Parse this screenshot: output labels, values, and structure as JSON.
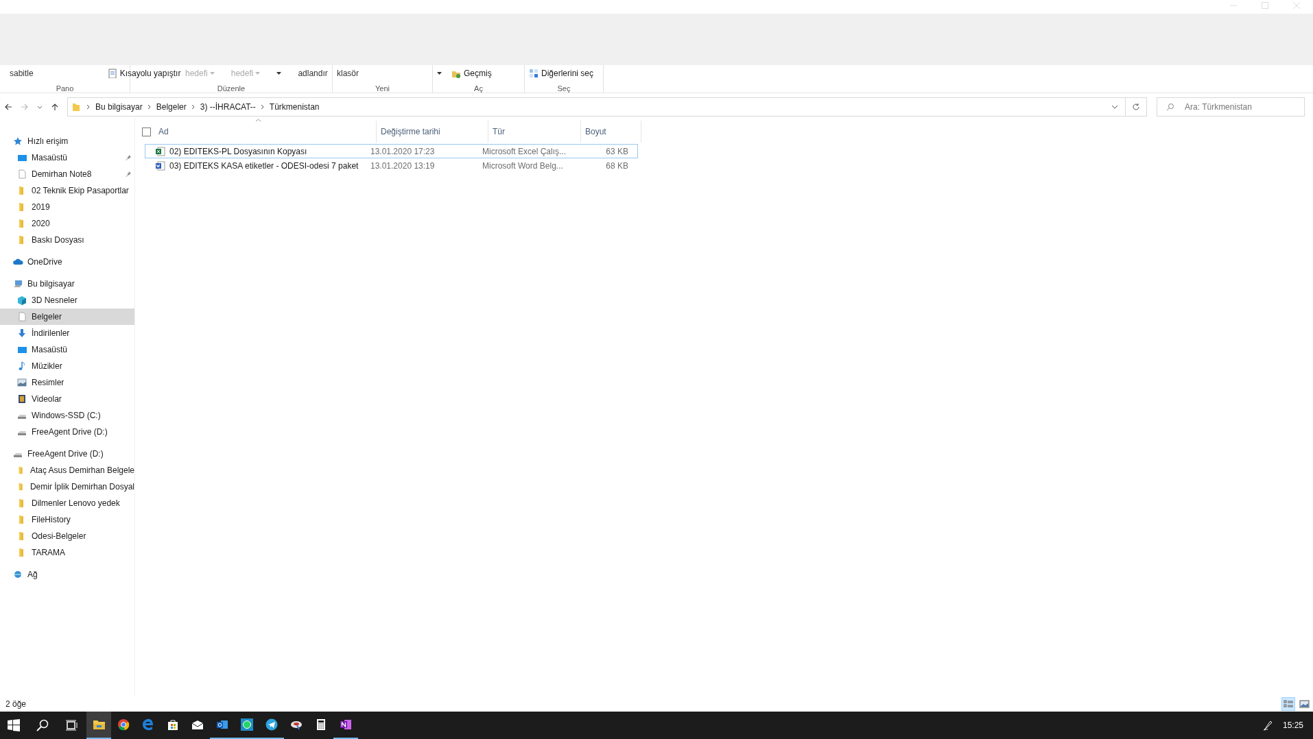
{
  "ribbon": {
    "groups": [
      {
        "label": "Pano",
        "items": [
          {
            "kind": "text",
            "text": "sabitle"
          },
          {
            "kind": "icon",
            "text": "Kısayolu yapıştır"
          }
        ]
      },
      {
        "label": "Düzenle",
        "items": [
          {
            "kind": "dropdown",
            "text": "hedefi"
          },
          {
            "kind": "dropdown",
            "text": "hedefi"
          },
          {
            "kind": "caret"
          },
          {
            "kind": "text",
            "text": "adlandır"
          }
        ]
      },
      {
        "label": "Yeni",
        "items": [
          {
            "kind": "text",
            "text": "klasör"
          }
        ]
      },
      {
        "label": "Aç",
        "items": [
          {
            "kind": "caret"
          },
          {
            "kind": "icon",
            "text": "Geçmiş"
          }
        ]
      },
      {
        "label": "Seç",
        "items": [
          {
            "kind": "icon",
            "text": "Diğerlerini seç"
          }
        ]
      }
    ]
  },
  "address": {
    "path": [
      "Bu bilgisayar",
      "Belgeler",
      "3) --İHRACAT--",
      "Türkmenistan"
    ],
    "search": {
      "placeholder": "Ara: Türkmenistan"
    }
  },
  "sidebar": {
    "items": [
      {
        "label": "Hızlı erişim",
        "kind": "star",
        "selected": false,
        "children": [
          {
            "label": "Masaüstü",
            "kind": "desktop",
            "pinned": true,
            "selected": false
          },
          {
            "label": "Demirhan Note8",
            "kind": "document",
            "pinned": true,
            "selected": false
          },
          {
            "label": "02 Teknik Ekip Pasaportlar",
            "kind": "folder",
            "pinned": false,
            "selected": false
          },
          {
            "label": "2019",
            "kind": "folder",
            "pinned": false,
            "selected": false
          },
          {
            "label": "2020",
            "kind": "folder",
            "pinned": false,
            "selected": false
          },
          {
            "label": "Baskı Dosyası",
            "kind": "folder",
            "pinned": false,
            "selected": false
          }
        ]
      },
      {
        "label": "OneDrive",
        "kind": "cloud",
        "selected": false
      },
      {
        "label": "Bu bilgisayar",
        "kind": "computer",
        "selected": false,
        "children": [
          {
            "label": "3D Nesneler",
            "kind": "cube",
            "selected": false
          },
          {
            "label": "Belgeler",
            "kind": "document",
            "selected": true
          },
          {
            "label": "İndirilenler",
            "kind": "download",
            "selected": false
          },
          {
            "label": "Masaüstü",
            "kind": "desktop",
            "selected": false
          },
          {
            "label": "Müzikler",
            "kind": "music",
            "selected": false
          },
          {
            "label": "Resimler",
            "kind": "image",
            "selected": false
          },
          {
            "label": "Videolar",
            "kind": "video",
            "selected": false
          },
          {
            "label": "Windows-SSD (C:)",
            "kind": "drive",
            "selected": false
          },
          {
            "label": "FreeAgent Drive (D:)",
            "kind": "drive",
            "selected": false
          }
        ]
      },
      {
        "label": "FreeAgent Drive (D:)",
        "kind": "drive",
        "selected": false,
        "children": [
          {
            "label": "Ataç Asus Demirhan Belgele",
            "kind": "folder",
            "selected": false
          },
          {
            "label": "Demir İplik Demirhan Dosyal",
            "kind": "folder",
            "selected": false
          },
          {
            "label": "Dilmenler Lenovo yedek",
            "kind": "folder",
            "selected": false
          },
          {
            "label": "FileHistory",
            "kind": "folder",
            "selected": false
          },
          {
            "label": "Odesi-Belgeler",
            "kind": "folder",
            "selected": false
          },
          {
            "label": "TARAMA",
            "kind": "folder",
            "selected": false
          }
        ]
      },
      {
        "label": "Ağ",
        "kind": "network",
        "selected": false
      }
    ]
  },
  "table": {
    "select_all": {
      "checked": false
    },
    "columns": [
      "Ad",
      "Değiştirme tarihi",
      "Tür",
      "Boyut"
    ],
    "rows": [
      {
        "kind": "sheet",
        "focused": true,
        "cells": [
          "02)  EDITEKS-PL Dosyasının Kopyası",
          "13.01.2020 17:23",
          "Microsoft Excel Çalış...",
          "63 KB"
        ]
      },
      {
        "kind": "word",
        "focused": false,
        "cells": [
          "03) EDITEKS KASA etiketler - ODESI-odesi 7 paket",
          "13.01.2020 13:19",
          "Microsoft Word Belg...",
          "68 KB"
        ]
      }
    ]
  },
  "status_bar": {
    "text": "2 öğe",
    "views": [
      {
        "kind": "details",
        "selected": true
      },
      {
        "kind": "thumbs",
        "selected": false
      }
    ]
  },
  "taskbar": {
    "apps": [
      {
        "kind": "folder",
        "running": true,
        "selected": true
      },
      {
        "kind": "ring",
        "running": false,
        "selected": false
      },
      {
        "kind": "letter-e",
        "running": false,
        "selected": false
      },
      {
        "kind": "bag",
        "running": false,
        "selected": false
      },
      {
        "kind": "envelope",
        "running": false,
        "selected": false
      },
      {
        "kind": "mail",
        "running": true,
        "selected": false
      },
      {
        "kind": "chat",
        "running": true,
        "selected": false
      },
      {
        "kind": "plane",
        "running": true,
        "selected": false
      },
      {
        "kind": "disc",
        "running": false,
        "selected": false
      },
      {
        "kind": "calculator",
        "running": false,
        "selected": false
      },
      {
        "kind": "notebook",
        "running": true,
        "selected": false
      }
    ],
    "clock": "15:25"
  }
}
